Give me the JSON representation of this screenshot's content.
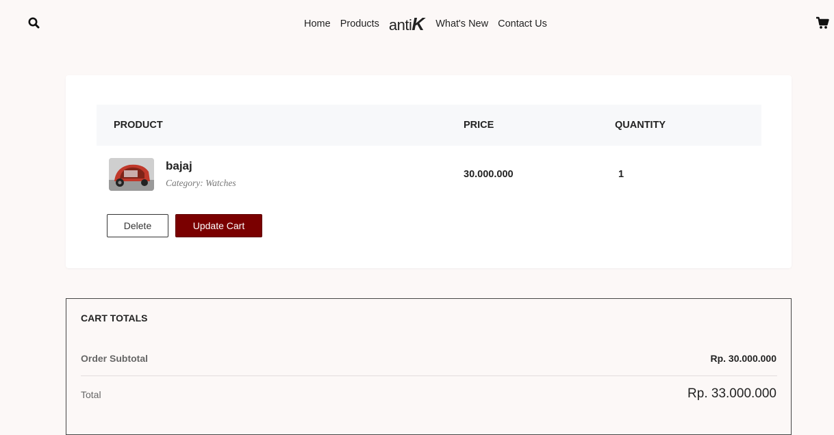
{
  "nav": {
    "home": "Home",
    "products": "Products",
    "logo_part1": "anti",
    "logo_part2": "K",
    "whats_new": "What's New",
    "contact": "Contact Us"
  },
  "icons": {
    "search": "search-icon",
    "cart": "cart-icon"
  },
  "cart_table": {
    "headers": {
      "product": "PRODUCT",
      "price": "PRICE",
      "quantity": "QUANTITY"
    },
    "items": [
      {
        "name": "bajaj",
        "category": "Category: Watches",
        "price": "30.000.000",
        "quantity": "1"
      }
    ],
    "delete_label": "Delete",
    "update_label": "Update Cart"
  },
  "totals": {
    "title": "CART TOTALS",
    "subtotal_label": "Order Subtotal",
    "subtotal_value": "Rp. 30.000.000",
    "total_label": "Total",
    "total_value": "Rp. 33.000.000"
  },
  "colors": {
    "page_bg": "#fcf8f7",
    "accent": "#7a0000",
    "table_header_bg": "#f7f8fa"
  }
}
